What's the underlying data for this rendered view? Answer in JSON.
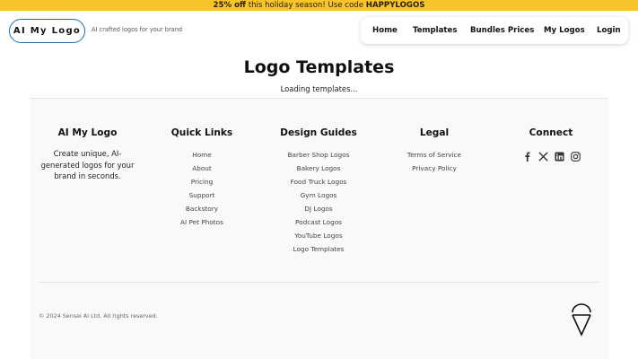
{
  "promo": {
    "highlight": "25% off",
    "middle": " this holiday season! Use code ",
    "code": "HAPPYLOGOS"
  },
  "header": {
    "logo_text": "AI My Logo",
    "tagline": "AI crafted logos for your brand",
    "nav": [
      {
        "label": "Home"
      },
      {
        "label": "Templates"
      },
      {
        "label": "Bundles Prices"
      },
      {
        "label": "My Logos"
      },
      {
        "label": "Login"
      }
    ]
  },
  "main": {
    "title": "Logo Templates",
    "loading": "Loading templates..."
  },
  "footer": {
    "brand": {
      "title": "AI My Logo",
      "description": "Create unique, AI-generated logos for your brand in seconds."
    },
    "quick_links": {
      "title": "Quick Links",
      "items": [
        "Home",
        "About",
        "Pricing",
        "Support",
        "Backstory",
        "AI Pet Photos"
      ]
    },
    "design_guides": {
      "title": "Design Guides",
      "items": [
        "Barber Shop Logos",
        "Bakery Logos",
        "Food Truck Logos",
        "Gym Logos",
        "DJ Logos",
        "Podcast Logos",
        "YouTube Logos",
        "Logo Templates"
      ]
    },
    "legal": {
      "title": "Legal",
      "items": [
        "Terms of Service",
        "Privacy Policy"
      ]
    },
    "connect": {
      "title": "Connect",
      "icons": [
        "facebook-icon",
        "x-icon",
        "linkedin-icon",
        "instagram-icon"
      ]
    },
    "copyright": "© 2024 Sensei AI Ltd. All rights reserved."
  },
  "colors": {
    "promo_bg": "#f7c52b",
    "logo_border": "#1f6fb0",
    "footer_bg": "#f9f9f9"
  }
}
